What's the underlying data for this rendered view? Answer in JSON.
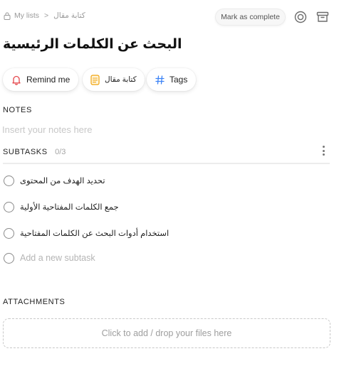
{
  "breadcrumb": {
    "root": "My lists",
    "separator": ">",
    "current": "كتابة مقال"
  },
  "toolbar": {
    "complete_label": "Mark as complete"
  },
  "task": {
    "title": "البحث عن الكلمات الرئيسية"
  },
  "chips": {
    "remind": "Remind me",
    "list": "كتابة مقال",
    "tags": "Tags"
  },
  "notes": {
    "label": "NOTES",
    "placeholder": "Insert your notes here",
    "value": ""
  },
  "subtasks": {
    "label": "SUBTASKS",
    "count": "0/3",
    "items": [
      {
        "label": "تحديد الهدف من المحتوى"
      },
      {
        "label": "جمع الكلمات المفتاحية الأولية"
      },
      {
        "label": "استخدام أدوات البحث عن الكلمات المفتاحية"
      }
    ],
    "add_placeholder": "Add a new subtask"
  },
  "attachments": {
    "label": "ATTACHMENTS",
    "dropzone_text": "Click to add / drop your files here"
  },
  "colors": {
    "accent_red": "#e5484d",
    "accent_orange": "#f0a20a",
    "accent_blue": "#3b82f6"
  }
}
